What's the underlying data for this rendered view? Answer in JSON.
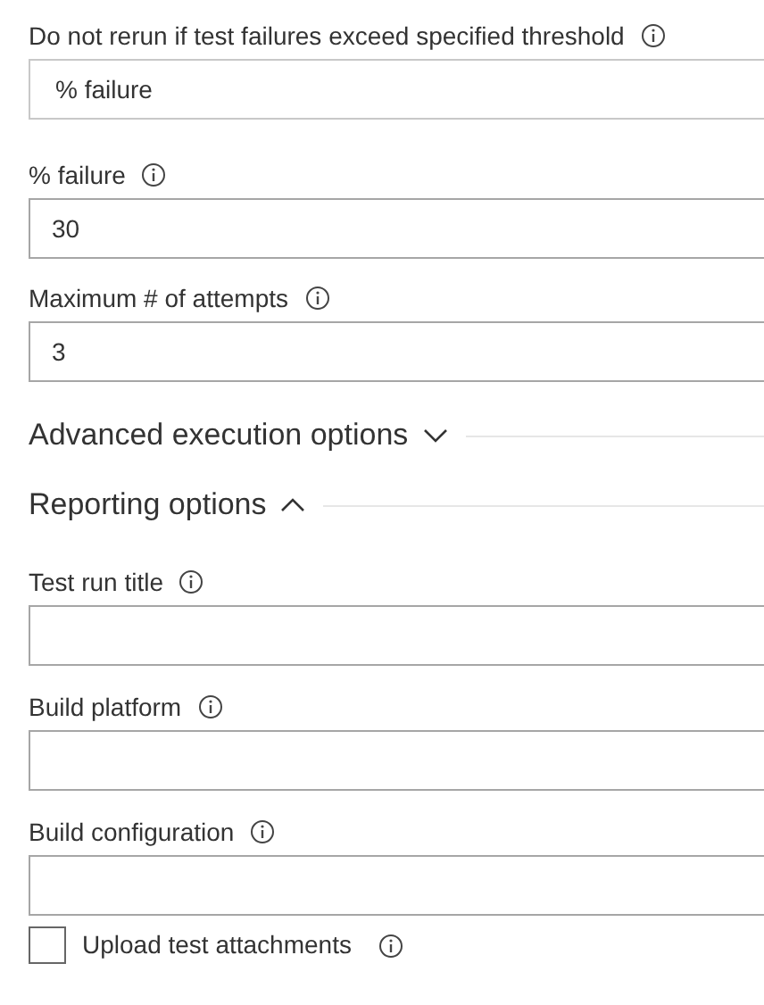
{
  "threshold_fields": [
    {
      "label": "Do not rerun if test failures exceed specified threshold",
      "kind": "dropdown",
      "value": "% failure"
    },
    {
      "label": "% failure",
      "kind": "text",
      "value": "30"
    },
    {
      "label": "Maximum # of attempts",
      "kind": "text",
      "value": "3"
    }
  ],
  "sections": [
    {
      "title": "Advanced execution options",
      "expanded": false
    },
    {
      "title": "Reporting options",
      "expanded": true
    }
  ],
  "reporting_fields": [
    {
      "label": "Test run title",
      "kind": "text"
    },
    {
      "label": "Build platform",
      "kind": "text"
    },
    {
      "label": "Build configuration",
      "kind": "text"
    }
  ],
  "upload_option": {
    "label": "Upload test attachments",
    "checked": false
  }
}
